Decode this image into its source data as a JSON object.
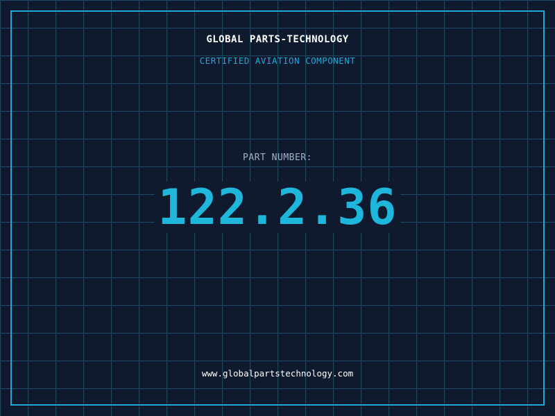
{
  "header": {
    "company_name": "GLOBAL PARTS-TECHNOLOGY",
    "tagline": "CERTIFIED AVIATION COMPONENT"
  },
  "part": {
    "label": "PART NUMBER:",
    "number": "122.2.36"
  },
  "footer": {
    "website": "www.globalpartstechnology.com"
  },
  "colors": {
    "background": "#0f1a2e",
    "grid": "#1f4a63",
    "accent": "#1ca9d8",
    "part_number": "#1fb6dc",
    "label": "#9fb3c8",
    "text": "#ffffff"
  }
}
